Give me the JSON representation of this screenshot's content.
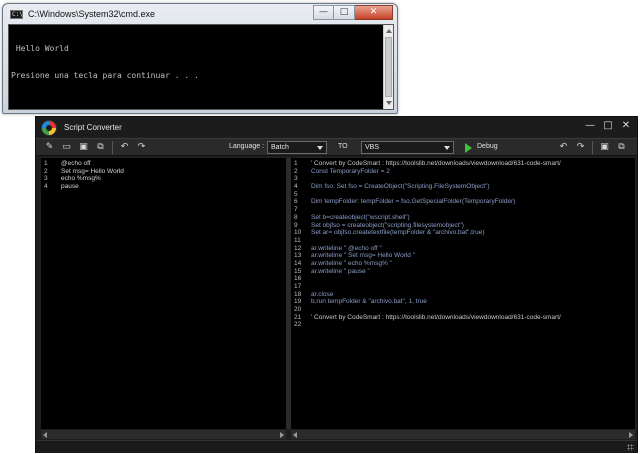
{
  "cmd_window": {
    "title": "C:\\Windows\\System32\\cmd.exe",
    "icon_text": "C:\\",
    "console_lines": [
      " Hello World",
      "Presione una tecla para continuar . . ."
    ],
    "controls": {
      "minimize": "—",
      "maximize": "□",
      "close": "✕"
    }
  },
  "converter": {
    "title": "Script Converter",
    "controls": {
      "minimize": "—",
      "maximize": "□",
      "close": "✕"
    },
    "toolbar": {
      "language_label": "Language :",
      "source_language": "Batch",
      "to_label": "TO",
      "target_language": "VBS",
      "debug_label": "Debug",
      "left_icons": [
        "open-icon",
        "folder-icon",
        "save-icon",
        "save-as-icon",
        "undo-icon",
        "redo-icon"
      ],
      "right_icons": [
        "undo-icon",
        "redo-icon",
        "save-icon",
        "save-as-icon"
      ]
    },
    "source_editor": {
      "line_numbers": [
        "1",
        "2",
        "3",
        "4"
      ],
      "lines": [
        "@echo off",
        "Set msg= Hello World",
        "echo %msg%",
        "pause"
      ]
    },
    "output_editor": {
      "line_numbers": [
        "1",
        "2",
        "3",
        "4",
        "5",
        "6",
        "7",
        "8",
        "9",
        "10",
        "11",
        "12",
        "13",
        "14",
        "15",
        "16",
        "17",
        "18",
        "19",
        "20",
        "21",
        "22"
      ],
      "lines": [
        "' Convert by CodeSmart : https://toolslib.net/downloads/viewdownload/631-code-smart/",
        "Const TemporaryFolder = 2",
        "",
        "Dim fso: Set fso = CreateObject(\"Scripting.FileSystemObject\")",
        "",
        "Dim tempFolder: tempFolder = fso.GetSpecialFolder(TemporaryFolder)",
        "",
        "Set b=createobject(\"wscript.shell\")",
        "Set objfso = createobject(\"scripting.filesystemobject\")",
        "Set ar= objfso.createtextfile(tempFolder & \"archivo.bat\",true)",
        "",
        "ar.writeline \" @echo off \"",
        "ar.writeline \" Set msg= Hello World \"",
        "ar.writeline \" echo %msg% \"",
        "ar.writeline \" pause \"",
        "",
        "",
        "ar.close",
        "b.run tempFolder & \"archivo.bat\", 1, true",
        "",
        "' Convert by CodeSmart : https://toolslib.net/downloads/viewdownload/631-code-smart/",
        ""
      ]
    }
  }
}
